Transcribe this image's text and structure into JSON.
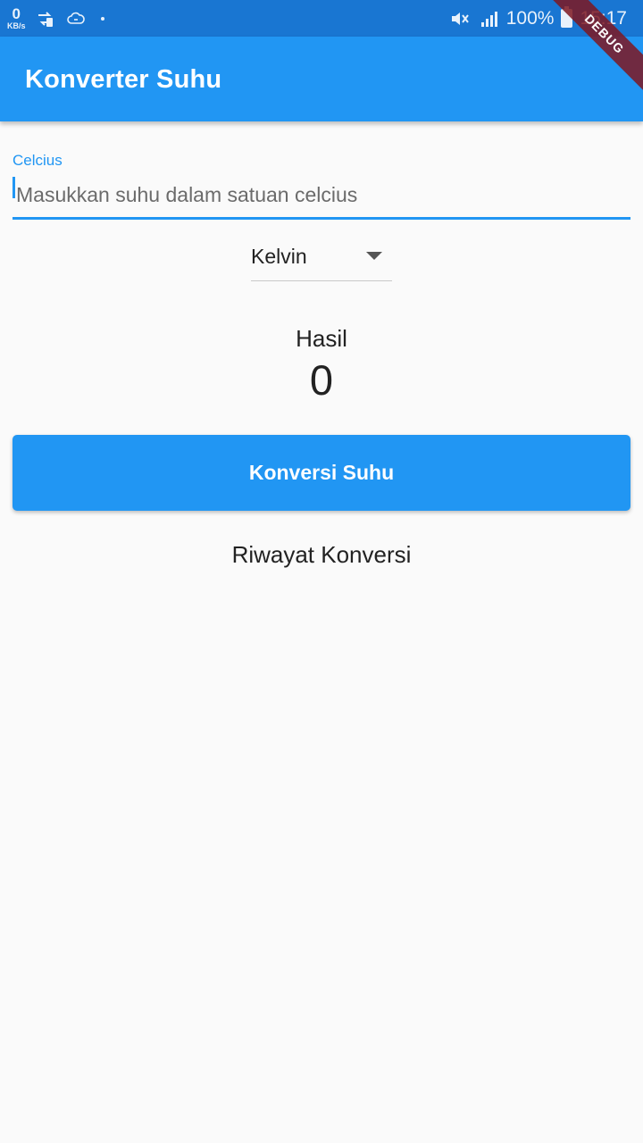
{
  "status_bar": {
    "network_speed": "0",
    "network_speed_unit": "KB/s",
    "battery_percent": "100%",
    "time": "15:17",
    "icons": [
      "data-transfer-icon",
      "cloud-sync-icon",
      "notification-dot",
      "mute-icon",
      "signal-icon",
      "battery-icon"
    ]
  },
  "app_bar": {
    "title": "Konverter Suhu",
    "debug_banner": "DEBUG"
  },
  "input": {
    "label": "Celcius",
    "placeholder": "Masukkan suhu dalam satuan celcius",
    "value": ""
  },
  "dropdown": {
    "selected": "Kelvin",
    "icon": "arrow-drop-down-icon"
  },
  "result": {
    "label": "Hasil",
    "value": "0"
  },
  "convert_button": {
    "label": "Konversi Suhu"
  },
  "history": {
    "title": "Riwayat Konversi"
  },
  "colors": {
    "primary": "#2196f3",
    "status_bar": "#1976d2",
    "background": "#fafafa",
    "debug_banner": "#7e1721"
  }
}
